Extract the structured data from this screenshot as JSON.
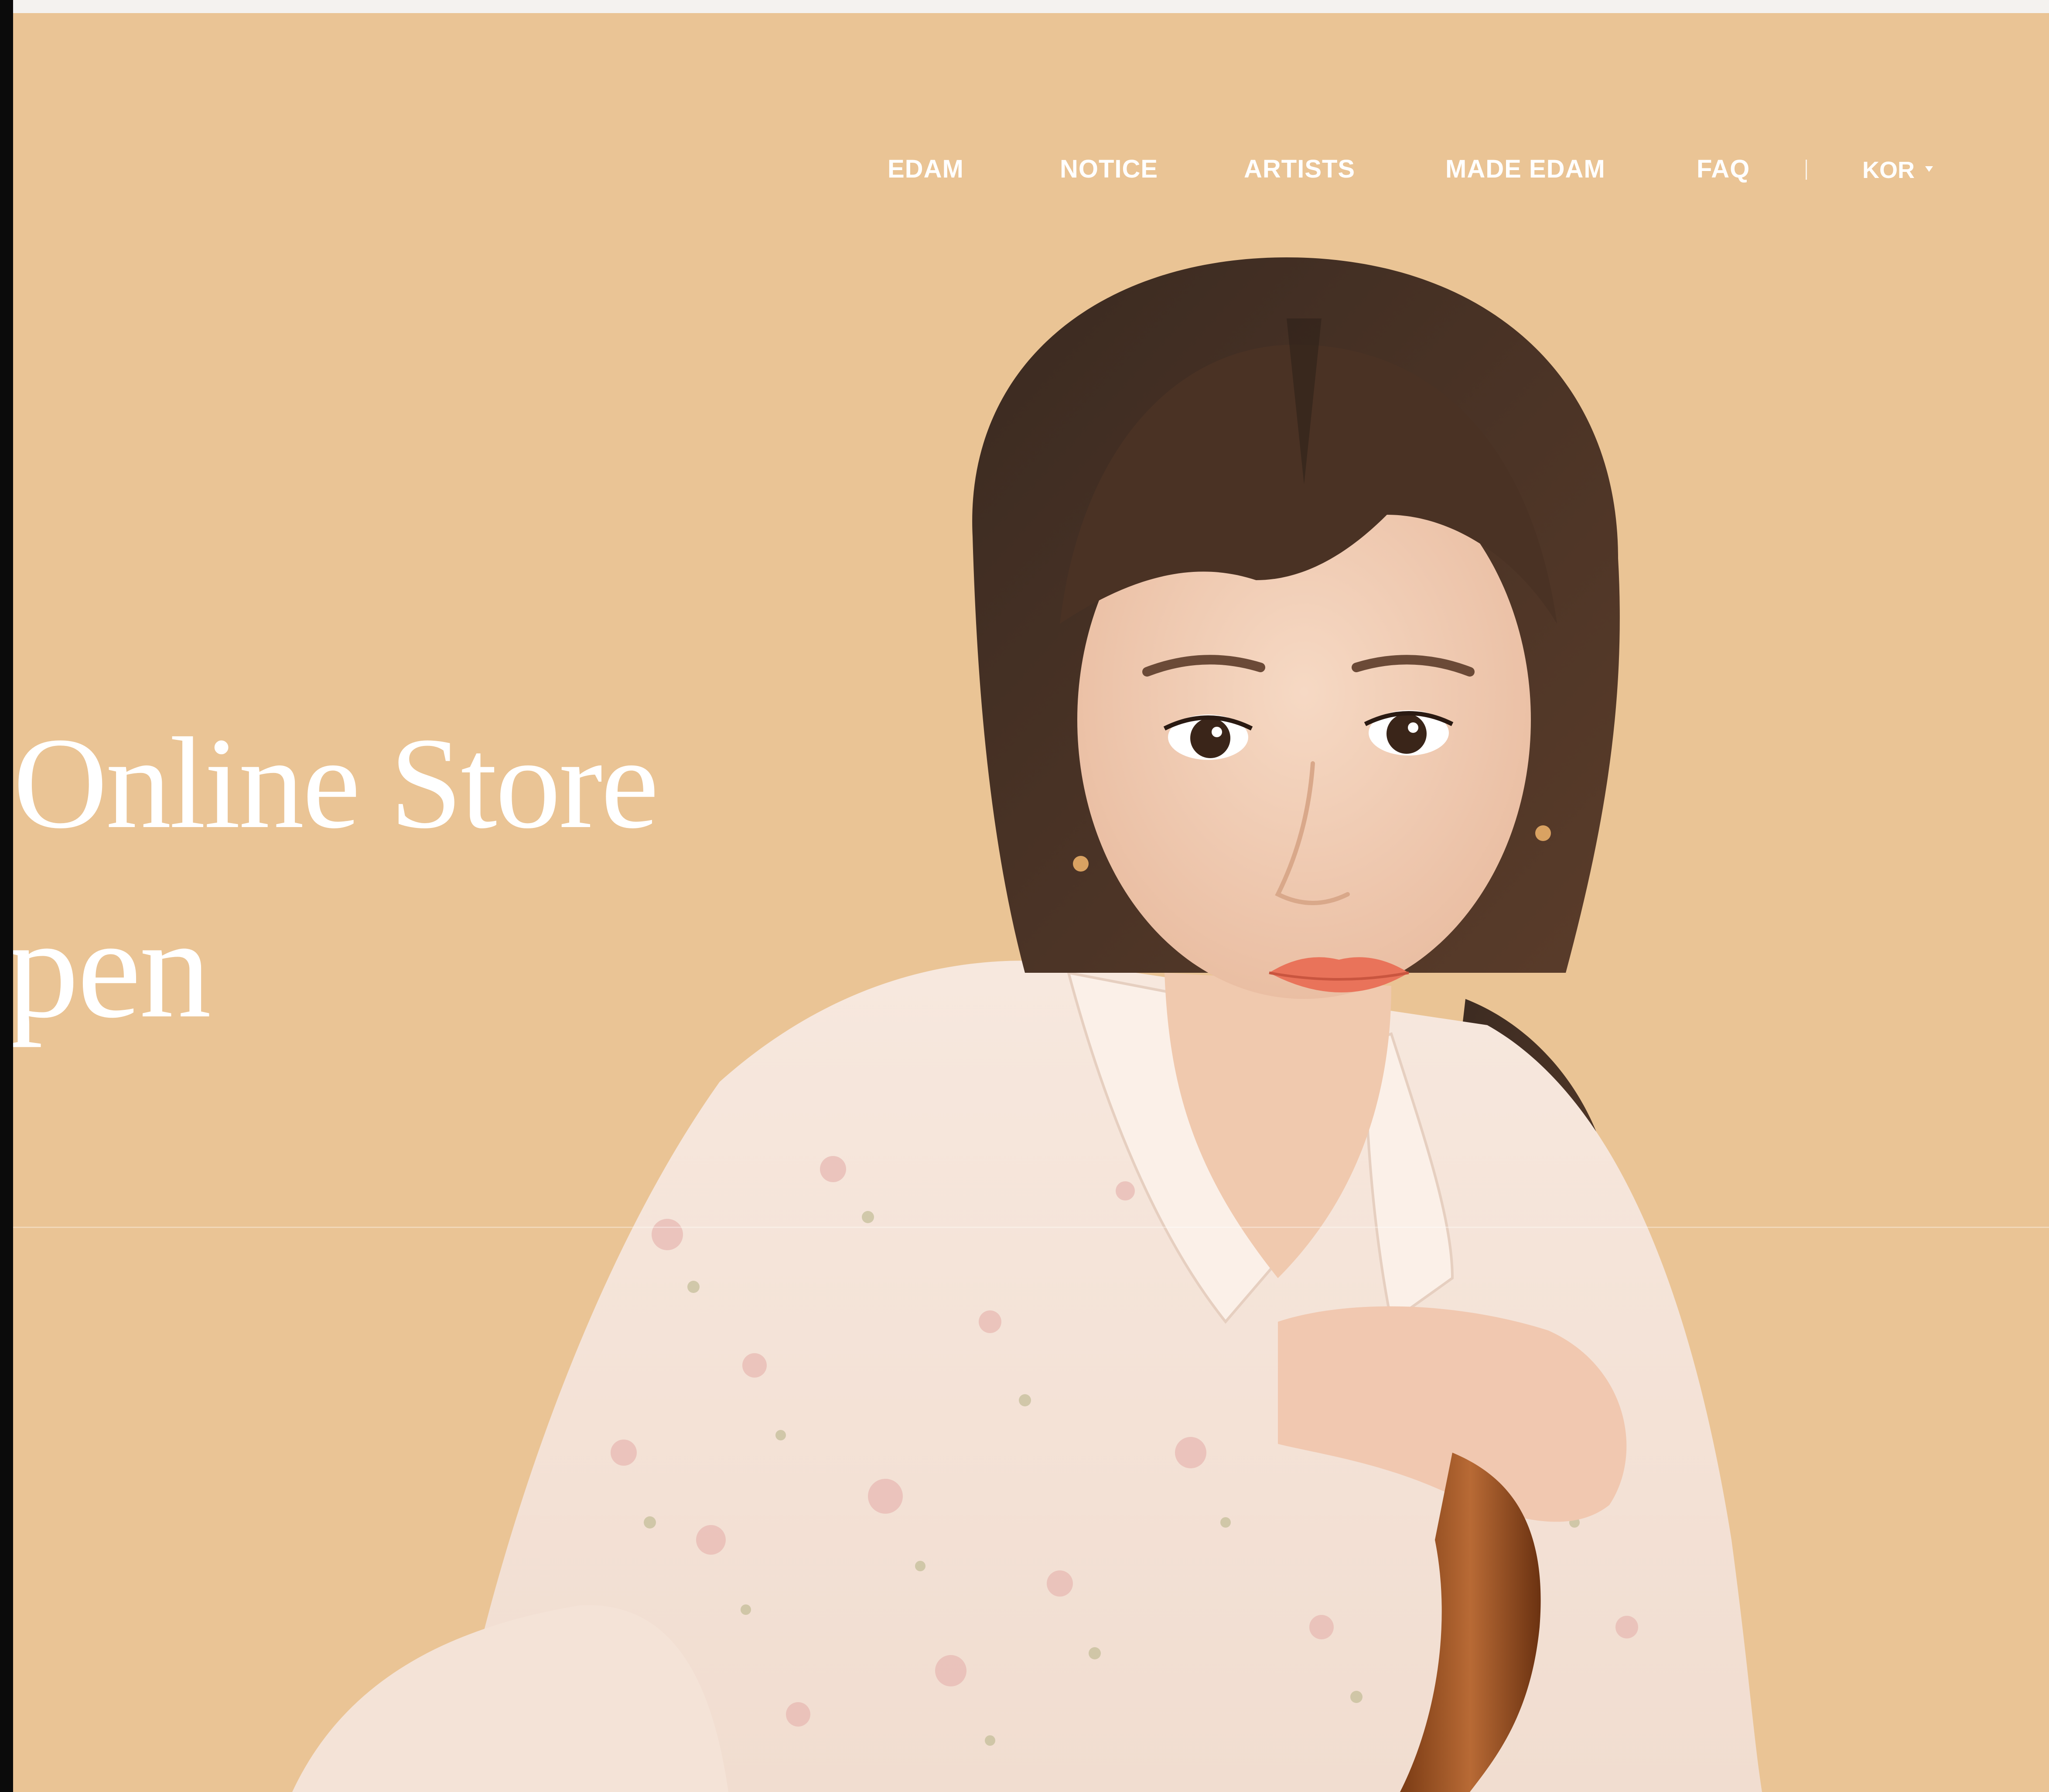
{
  "nav": {
    "items": [
      {
        "label": "EDAM"
      },
      {
        "label": "NOTICE"
      },
      {
        "label": "ARTISTS"
      },
      {
        "label": "MADE EDAM"
      },
      {
        "label": "FAQ"
      }
    ],
    "language": "KOR"
  },
  "hero": {
    "headline_line1": "Online Store",
    "headline_line2": "pen",
    "background_color": "#eac495"
  }
}
